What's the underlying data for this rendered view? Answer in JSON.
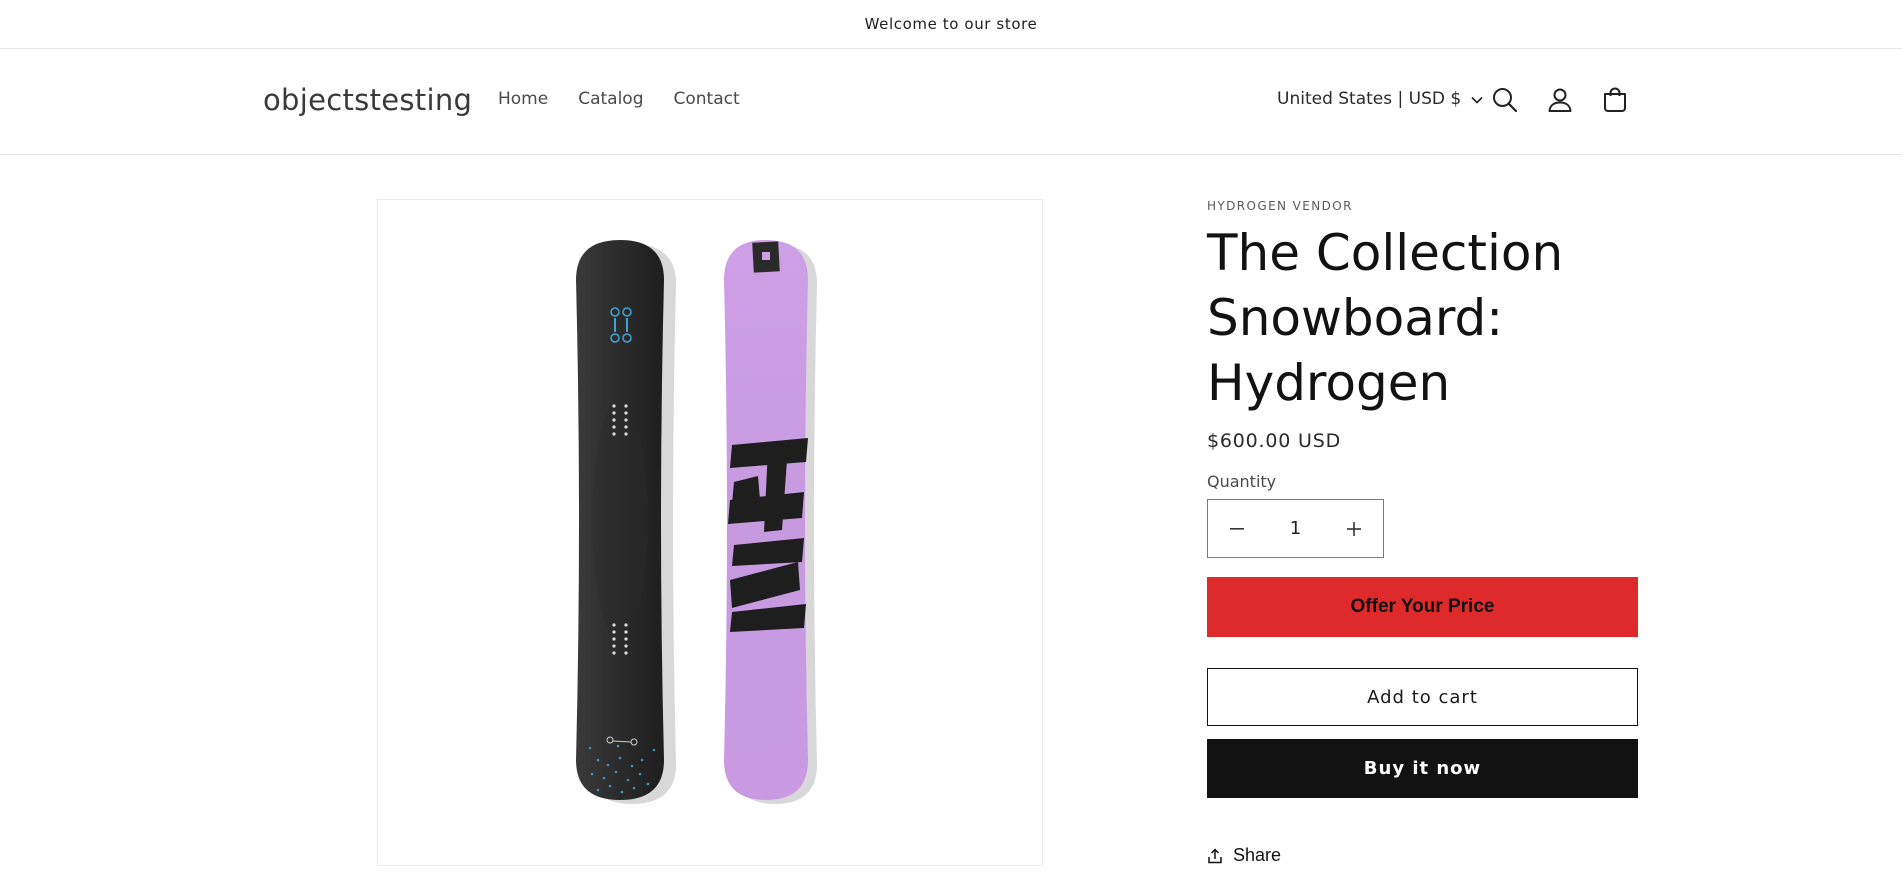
{
  "announcement": {
    "text": "Welcome to our store"
  },
  "header": {
    "logo": "objectstesting",
    "nav": [
      {
        "label": "Home"
      },
      {
        "label": "Catalog"
      },
      {
        "label": "Contact"
      }
    ],
    "locale": "United States | USD $",
    "icons": [
      "search-icon",
      "account-icon",
      "cart-icon"
    ]
  },
  "product": {
    "vendor": "HYDROGEN VENDOR",
    "title": "The Collection Snowboard: Hydrogen",
    "price": "$600.00 USD",
    "quantity_label": "Quantity",
    "quantity_value": "1",
    "offer_label": "Offer Your Price",
    "add_to_cart_label": "Add to cart",
    "buy_now_label": "Buy it now",
    "share_label": "Share"
  },
  "colors": {
    "offer_button": "#de2a2a",
    "buy_now_button": "#121212",
    "board_dark": "#2f2f2f",
    "board_purple": "#c99ae2"
  }
}
